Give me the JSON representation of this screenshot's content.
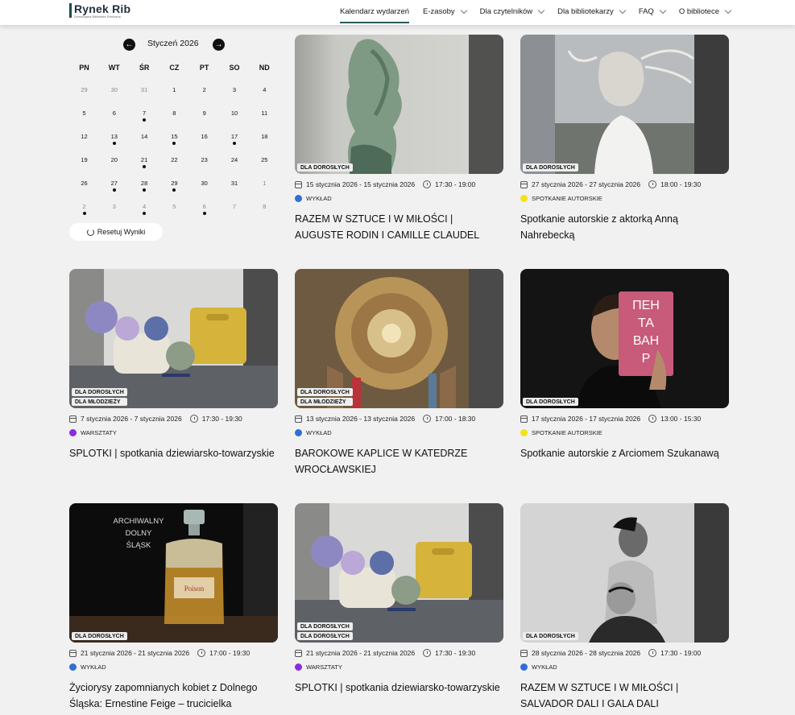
{
  "header": {
    "logo": {
      "name": "Rynek Rib",
      "subtitle": "Dolnośląska Biblioteka Publiczna"
    },
    "nav": [
      {
        "label": "Kalendarz wydarzeń",
        "dropdown": false,
        "active": true
      },
      {
        "label": "E-zasoby",
        "dropdown": true,
        "active": false
      },
      {
        "label": "Dla czytelników",
        "dropdown": true,
        "active": false
      },
      {
        "label": "Dla bibliotekarzy",
        "dropdown": true,
        "active": false
      },
      {
        "label": "FAQ",
        "dropdown": true,
        "active": false
      },
      {
        "label": "O bibliotece",
        "dropdown": true,
        "active": false
      }
    ]
  },
  "calendar": {
    "title": "Styczeń 2026",
    "prev_icon": "arrow-left-icon",
    "next_icon": "arrow-right-icon",
    "weekdays": [
      "PN",
      "WT",
      "ŚR",
      "CZ",
      "PT",
      "SO",
      "ND"
    ],
    "weeks": [
      [
        {
          "d": "29",
          "m": true
        },
        {
          "d": "30",
          "m": true
        },
        {
          "d": "31",
          "m": true
        },
        {
          "d": "1"
        },
        {
          "d": "2"
        },
        {
          "d": "3"
        },
        {
          "d": "4"
        }
      ],
      [
        {
          "d": "5"
        },
        {
          "d": "6"
        },
        {
          "d": "7",
          "e": true
        },
        {
          "d": "8"
        },
        {
          "d": "9"
        },
        {
          "d": "10"
        },
        {
          "d": "11"
        }
      ],
      [
        {
          "d": "12"
        },
        {
          "d": "13",
          "e": true
        },
        {
          "d": "14"
        },
        {
          "d": "15",
          "e": true
        },
        {
          "d": "16"
        },
        {
          "d": "17",
          "e": true
        },
        {
          "d": "18"
        }
      ],
      [
        {
          "d": "19"
        },
        {
          "d": "20"
        },
        {
          "d": "21",
          "e": true
        },
        {
          "d": "22"
        },
        {
          "d": "23"
        },
        {
          "d": "24"
        },
        {
          "d": "25"
        }
      ],
      [
        {
          "d": "26"
        },
        {
          "d": "27",
          "e": true
        },
        {
          "d": "28",
          "e": true
        },
        {
          "d": "29",
          "e": true
        },
        {
          "d": "30"
        },
        {
          "d": "31"
        },
        {
          "d": "1",
          "m": true
        }
      ],
      [
        {
          "d": "2",
          "m": true,
          "e": true
        },
        {
          "d": "3",
          "m": true
        },
        {
          "d": "4",
          "m": true,
          "e": true
        },
        {
          "d": "5",
          "m": true
        },
        {
          "d": "6",
          "m": true,
          "e": true
        },
        {
          "d": "7",
          "m": true
        },
        {
          "d": "8",
          "m": true
        }
      ]
    ],
    "reset_label": "Resetuj Wyniki"
  },
  "events": [
    {
      "badges": [
        "DLA DOROSŁYCH"
      ],
      "date": "15 stycznia 2026 - 15 stycznia 2026",
      "time": "17:30 - 19:00",
      "category": "WYKŁAD",
      "category_color": "#2f6fd6",
      "title": "RAZEM W SZTUCE I W MIŁOŚCI | AUGUSTE RODIN I CAMILLE CLAUDEL",
      "image": "sculpture"
    },
    {
      "badges": [
        "DLA DOROSŁYCH"
      ],
      "date": "27 stycznia 2026 - 27 stycznia 2026",
      "time": "18:00 - 19:30",
      "category": "SPOTKANIE AUTORSKIE",
      "category_color": "#f2e21a",
      "title": "Spotkanie autorskie z aktorką Anną Nahrebecką",
      "image": "portrait-woman"
    },
    {
      "badges": [
        "DLA DOROSŁYCH",
        "DLA MŁODZIEŻY"
      ],
      "date": "7 stycznia 2026 - 7 stycznia 2026",
      "time": "17:30 - 19:30",
      "category": "WARSZTATY",
      "category_color": "#8a2be2",
      "title": "SPLOTKI | spotkania dziewiarsko-towarzyskie",
      "image": "yarn"
    },
    {
      "badges": [
        "DLA DOROSŁYCH",
        "DLA MŁODZIEŻY"
      ],
      "date": "13 stycznia 2026 - 13 stycznia 2026",
      "time": "17:00 - 18:30",
      "category": "WYKŁAD",
      "category_color": "#2f6fd6",
      "title": "BAROKOWE KAPLICE W KATEDRZE WROCŁAWSKIEJ",
      "image": "chapel"
    },
    {
      "badges": [
        "DLA DOROSŁYCH"
      ],
      "date": "17 stycznia 2026 - 17 stycznia 2026",
      "time": "13:00 - 15:30",
      "category": "SPOTKANIE AUTORSKIE",
      "category_color": "#f2e21a",
      "title": "Spotkanie autorskie z Arciomem Szukanawą",
      "image": "man-book",
      "image_text": "ПЕН ТА ВАН Р"
    },
    {
      "badges": [
        "DLA DOROSŁYCH"
      ],
      "date": "21 stycznia 2026 - 21 stycznia 2026",
      "time": "17:00 - 19:30",
      "category": "WYKŁAD",
      "category_color": "#2f6fd6",
      "title": "Życiorysy zapomnianych kobiet z Dolnego Śląska: Ernestine Feige – trucicielka",
      "image": "poison",
      "image_text": "ARCHIWALNY DOLNY ŚLĄSK",
      "image_label": "Poison"
    },
    {
      "badges": [
        "DLA DOROSŁYCH",
        "DLA DOROSŁYCH"
      ],
      "date": "21 stycznia 2026 - 21 stycznia 2026",
      "time": "17:30 - 19:30",
      "category": "WARSZTATY",
      "category_color": "#8a2be2",
      "title": "SPLOTKI | spotkania dziewiarsko-towarzyskie",
      "image": "yarn"
    },
    {
      "badges": [
        "DLA DOROSŁYCH"
      ],
      "date": "28 stycznia 2026 - 28 stycznia 2026",
      "time": "17:30 - 19:00",
      "category": "WYKŁAD",
      "category_color": "#2f6fd6",
      "title": "RAZEM W SZTUCE I W MIŁOŚCI | SALVADOR DALI I GALA DALI",
      "image": "dali"
    }
  ]
}
